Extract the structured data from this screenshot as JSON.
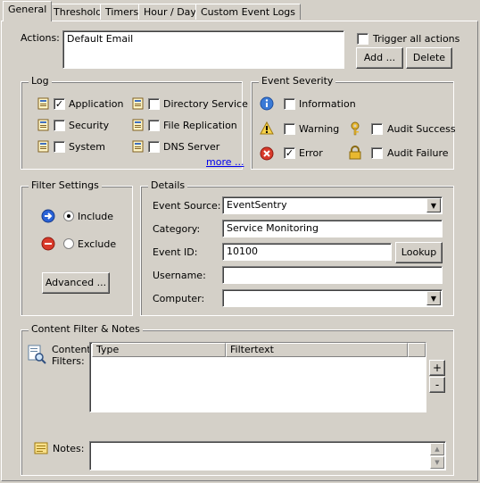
{
  "tabs": [
    "General",
    "Threshold",
    "Timers",
    "Hour / Day",
    "Custom Event Logs"
  ],
  "actions": {
    "label": "Actions:",
    "value": "Default Email",
    "trigger_all": "Trigger all actions",
    "add": "Add ...",
    "delete": "Delete"
  },
  "log": {
    "caption": "Log",
    "items": [
      {
        "label": "Application",
        "checked": true
      },
      {
        "label": "Security",
        "checked": false
      },
      {
        "label": "System",
        "checked": false
      },
      {
        "label": "Directory Service",
        "checked": false
      },
      {
        "label": "File Replication",
        "checked": false
      },
      {
        "label": "DNS Server",
        "checked": false
      }
    ],
    "more": "more ..."
  },
  "severity": {
    "caption": "Event Severity",
    "information": "Information",
    "warning": "Warning",
    "error": "Error",
    "audit_success": "Audit Success",
    "audit_failure": "Audit Failure"
  },
  "filter": {
    "caption": "Filter Settings",
    "include": "Include",
    "exclude": "Exclude",
    "advanced": "Advanced ..."
  },
  "details": {
    "caption": "Details",
    "source_label": "Event Source:",
    "source_value": "EventSentry",
    "category_label": "Category:",
    "category_value": "Service Monitoring",
    "eventid_label": "Event ID:",
    "eventid_value": "10100",
    "lookup": "Lookup",
    "username_label": "Username:",
    "username_value": "",
    "computer_label": "Computer:",
    "computer_value": ""
  },
  "content": {
    "caption": "Content Filter & Notes",
    "filters_label1": "Content",
    "filters_label2": "Filters:",
    "col_type": "Type",
    "col_filtertext": "Filtertext",
    "plus": "+",
    "minus": "-",
    "notes_label": "Notes:"
  }
}
